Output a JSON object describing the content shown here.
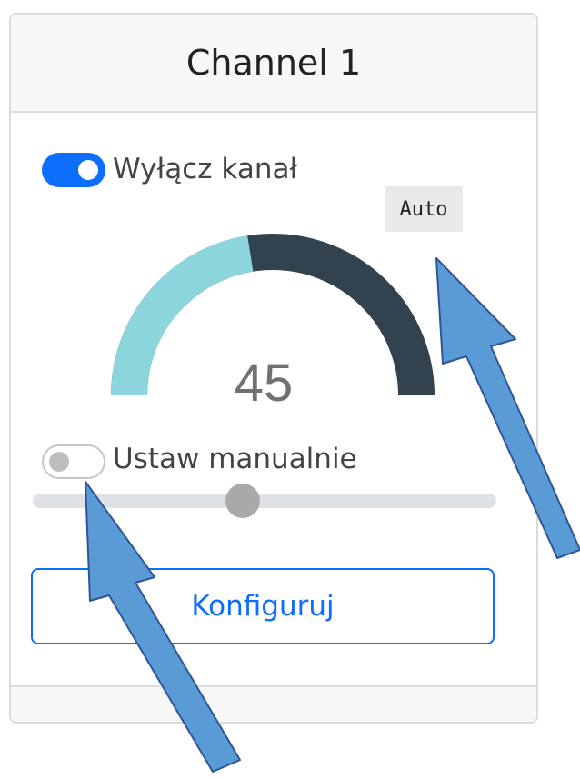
{
  "channel": {
    "title": "Channel 1",
    "enable_toggle": {
      "label": "Wyłącz kanał",
      "checked": true
    },
    "mode_badge": "Auto",
    "gauge": {
      "value": 45,
      "display": "45",
      "min": 0,
      "max": 100,
      "fill_color": "#8dd5dc",
      "track_color": "#33424f"
    },
    "manual_toggle": {
      "label": "Ustaw manualnie",
      "checked": false
    },
    "slider": {
      "value": 45,
      "min": 0,
      "max": 100
    },
    "configure_button": "Konfiguruj"
  },
  "annotations": {
    "arrow_color": "#5b9bd5",
    "arrow_outline": "#2f5597",
    "targets": [
      "mode-badge",
      "manual-mode-toggle"
    ]
  },
  "colors": {
    "primary": "#0d6efd",
    "header_bg": "#f7f7f7",
    "border": "#dcdcdc"
  }
}
